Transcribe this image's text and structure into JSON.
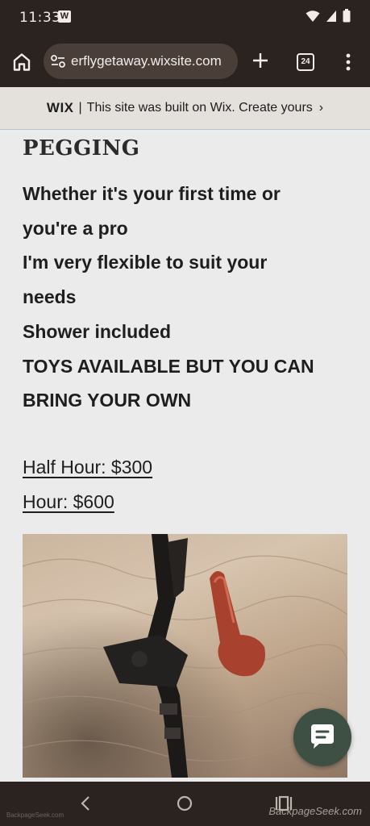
{
  "status_bar": {
    "time": "11:33",
    "notification_badge": "W"
  },
  "browser": {
    "url": "erflygetaway.wixsite.com",
    "tab_count": "24"
  },
  "wix_banner": {
    "logo": "WIX",
    "separator": "|",
    "text": "This site was built on Wix. Create yours",
    "chevron": "›"
  },
  "content": {
    "heading": "PEGGING",
    "lines": [
      "Whether it's your first time or",
      "you're a pro",
      "I'm very flexible to suit your",
      "needs",
      "Shower included",
      "TOYS AVAILABLE BUT YOU CAN",
      "BRING YOUR OWN"
    ],
    "prices": {
      "half_hour": "Half Hour: $300",
      "hour": "Hour: $600"
    }
  },
  "watermark": {
    "right": "BackpageSeek.com",
    "left": "BackpageSeek.com"
  },
  "colors": {
    "chrome_bg": "#2b2320",
    "url_pill": "#4a3e39",
    "page_bg": "#ebebeb",
    "chat_fab": "#3d5043"
  }
}
